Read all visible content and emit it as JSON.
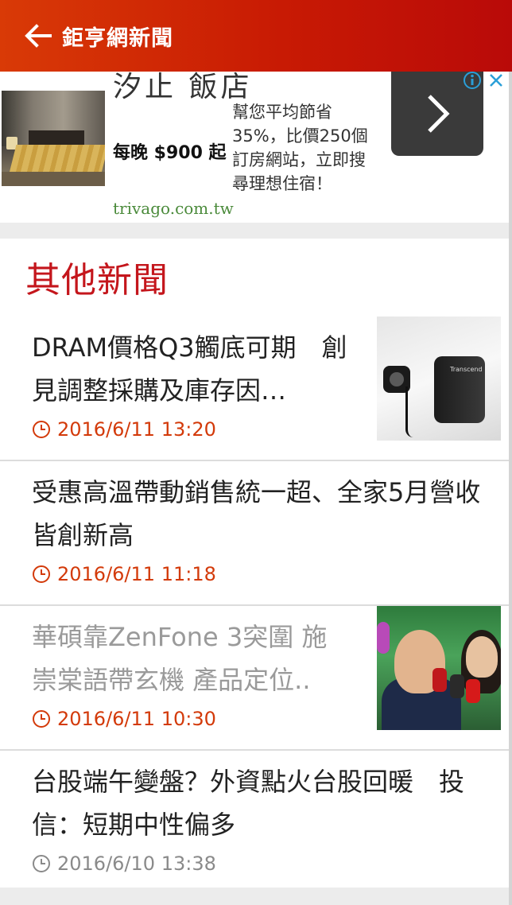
{
  "header": {
    "title": "鉅亨網新聞",
    "back_icon": "arrow-left-icon",
    "background": "#c81a04"
  },
  "ad": {
    "hotel_name": "汐止 飯店",
    "price": "每晚 $900 起",
    "description": "幫您平均節省35%，比價250個訂房網站，立即搜尋理想住宿！",
    "url": "trivago.com.tw",
    "next_icon": "chevron-right-icon",
    "info_icon": "info-icon",
    "close_icon": "close-icon"
  },
  "news": {
    "section_title": "其他新聞",
    "items": [
      {
        "title": "DRAM價格Q3觸底可期　創見調整採購及庫存因…",
        "date": "2016/6/11 13:20",
        "has_thumb": true,
        "read": false
      },
      {
        "title": "受惠高溫帶動銷售統一超、全家5月營收皆創新高",
        "date": "2016/6/11 11:18",
        "has_thumb": false,
        "read": false
      },
      {
        "title": "華碩靠ZenFone 3突圍 施崇棠語帶玄機 產品定位..",
        "date": "2016/6/11 10:30",
        "has_thumb": true,
        "read": true
      },
      {
        "title": "台股端午變盤？外資點火台股回暖　投信：短期中性偏多",
        "date": "2016/6/10 13:38",
        "has_thumb": false,
        "read": false
      }
    ]
  },
  "colors": {
    "accent_red": "#c4161c",
    "date_orange": "#d33a0a",
    "date_gray": "#8a8a8a"
  }
}
